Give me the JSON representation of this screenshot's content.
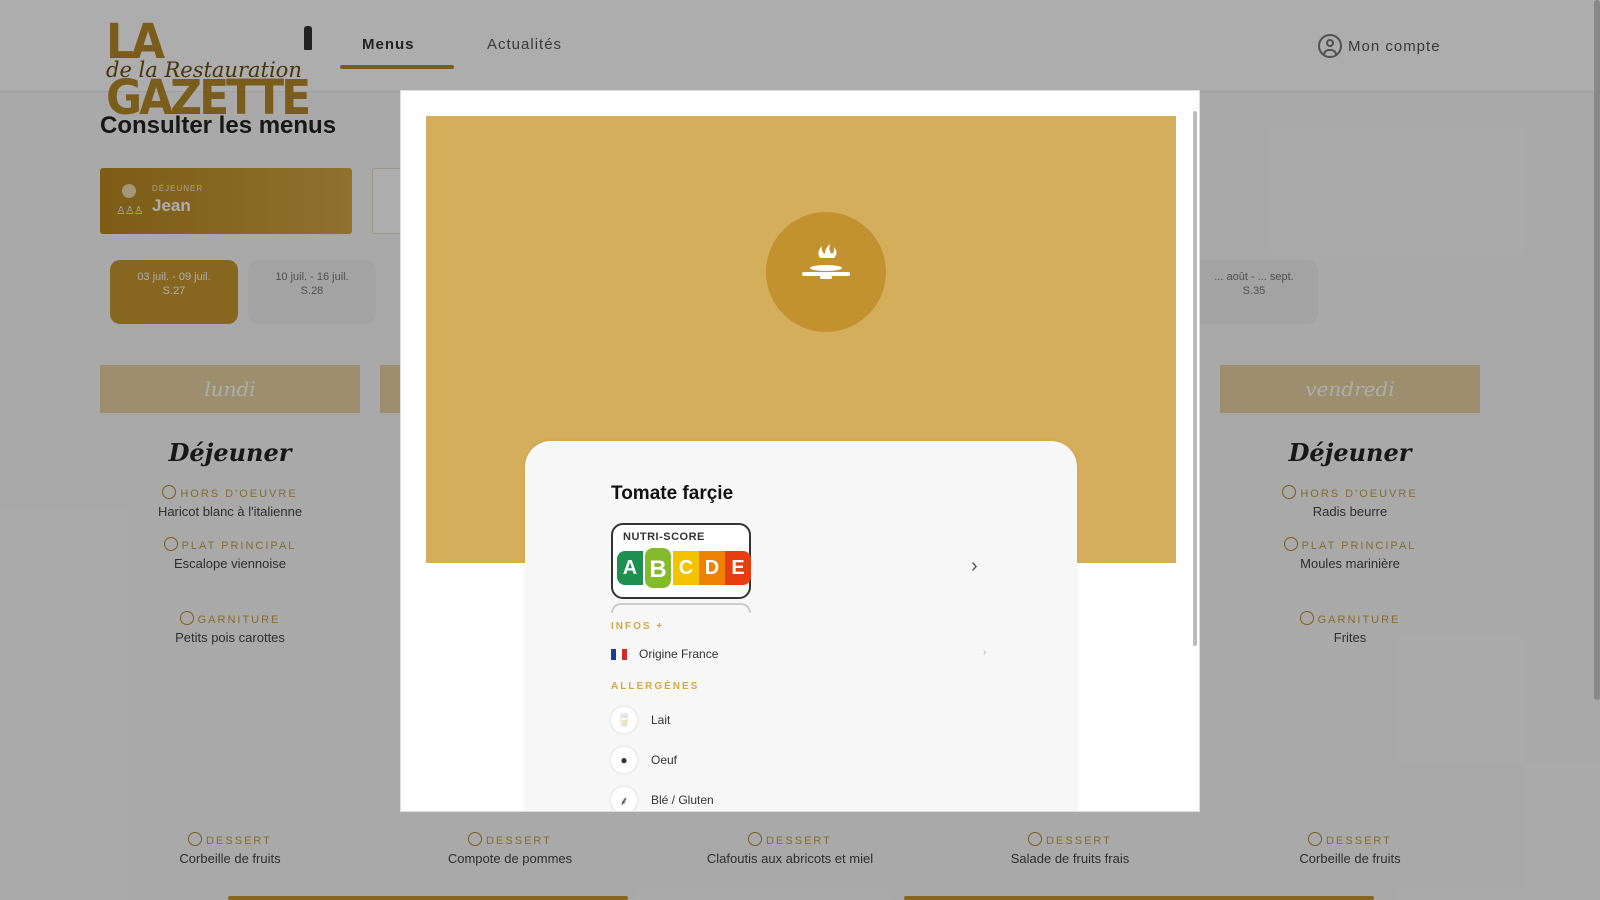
{
  "header": {
    "logo_line1": "LA GAZETTE",
    "logo_line2": "de la Restauration",
    "nav": {
      "menus": "Menus",
      "news": "Actualités"
    },
    "account": "Mon compte"
  },
  "page": {
    "title": "Consulter les menus",
    "restaurants": [
      {
        "small": "DÉJEUNER",
        "name": "Jean",
        "active": true
      }
    ],
    "weeks": [
      {
        "dates": "03 juil. - 09 juil.",
        "num": "S.27",
        "active": true
      },
      {
        "dates": "10 juil. - 16 juil.",
        "num": "S.28",
        "active": false
      },
      {
        "dates": "... août - ... sept.",
        "num": "S.35",
        "active": false
      }
    ],
    "days": [
      {
        "name": "lundi",
        "meal": "Déjeuner",
        "starter_label": "HORS D'OEUVRE",
        "starter": "Haricot blanc à l'italienne",
        "main_label": "PLAT PRINCIPAL",
        "main": "Escalope viennoise",
        "side_label": "GARNITURE",
        "side": "Petits pois carottes",
        "dessert_label": "DESSERT",
        "dessert": "Corbeille de fruits"
      },
      {
        "dessert_label": "DESSERT",
        "dessert": "Compote de pommes"
      },
      {
        "dessert_label": "DESSERT",
        "dessert": "Clafoutis aux abricots et miel"
      },
      {
        "dessert_label": "DESSERT",
        "dessert": "Salade de fruits frais"
      },
      {
        "name": "vendredi",
        "meal": "Déjeuner",
        "starter_label": "HORS D'OEUVRE",
        "starter": "Radis beurre",
        "main_label": "PLAT PRINCIPAL",
        "main": "Moules marinière",
        "side_label": "GARNITURE",
        "side": "Frites",
        "dessert_label": "DESSERT",
        "dessert": "Corbeille de fruits"
      }
    ]
  },
  "modal": {
    "dish_title": "Tomate farçie",
    "nutriscore": {
      "label": "NUTRI-SCORE",
      "letters": [
        "A",
        "B",
        "C",
        "D",
        "E"
      ],
      "selected": "B"
    },
    "info_label": "INFOS +",
    "origin": "Origine France",
    "origin_flag": [
      "#1f3a93",
      "#ffffff",
      "#d62828"
    ],
    "allergens_label": "ALLERGÈNES",
    "allergens": [
      "Lait",
      "Oeuf",
      "Blé / Gluten"
    ]
  },
  "colors": {
    "gold": "#c7992e",
    "gold_light": "#d4ae5b",
    "overlay": "rgba(0,0,0,0.32)"
  }
}
